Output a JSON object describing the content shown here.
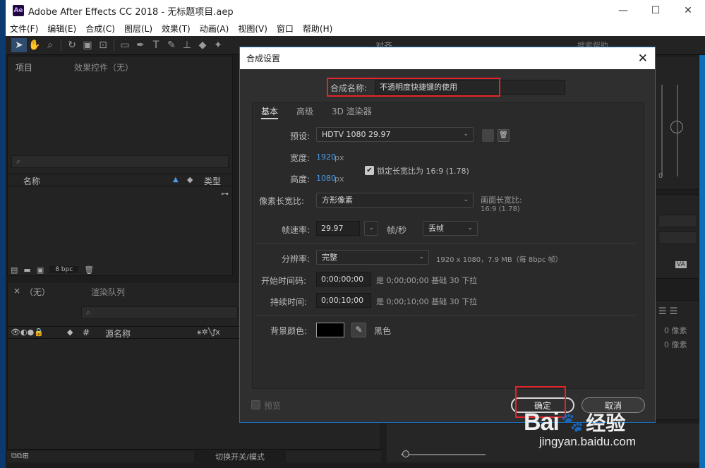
{
  "window": {
    "title": "Adobe After Effects CC 2018 - 无标题项目.aep",
    "logo": "Ae",
    "controls": {
      "minimize": "—",
      "maximize": "☐",
      "close": "✕"
    }
  },
  "menu": [
    "文件(F)",
    "编辑(E)",
    "合成(C)",
    "图层(L)",
    "效果(T)",
    "动画(A)",
    "视图(V)",
    "窗口",
    "帮助(H)"
  ],
  "toolbar": {
    "align_label": "对齐",
    "help_search": "搜索帮助"
  },
  "project_panel": {
    "tab": "项目",
    "tab2": "效果控件（无）",
    "col_name": "名称",
    "col_type": "类型",
    "bpc": "8 bpc"
  },
  "timeline_panel": {
    "tab": "（无）",
    "tab2": "渲染队列",
    "col_hash": "#",
    "col_source": "源名称",
    "footer": "切换开关/模式"
  },
  "right_panel": {
    "val0": "0",
    "px1": "0 像素",
    "px2": "0 像素"
  },
  "dialog": {
    "title": "合成设置",
    "close": "✕",
    "name_label": "合成名称:",
    "name_value": "不透明度快捷键的使用",
    "tabs": [
      "基本",
      "高级",
      "3D 渲染器"
    ],
    "preset_label": "预设:",
    "preset_value": "HDTV 1080 29.97",
    "width_label": "宽度:",
    "width_value": "1920",
    "width_unit": "px",
    "height_label": "高度:",
    "height_value": "1080",
    "height_unit": "px",
    "lock_label": "锁定长宽比为 16:9 (1.78)",
    "pixel_aspect_label": "像素长宽比:",
    "pixel_aspect_value": "方形像素",
    "frame_aspect_label": "画面长宽比:",
    "frame_aspect_value": "16:9 (1.78)",
    "fps_label": "帧速率:",
    "fps_value": "29.97",
    "fps_unit": "帧/秒",
    "drop_frame": "丢帧",
    "resolution_label": "分辨率:",
    "resolution_value": "完整",
    "resolution_info": "1920 x 1080，7.9 MB（每 8bpc 帧）",
    "start_tc_label": "开始时间码:",
    "start_tc_value": "0;00;00;00",
    "start_tc_info": "是 0;00;00;00  基础 30  下拉",
    "duration_label": "持续时间:",
    "duration_value": "0;00;10;00",
    "duration_info": "是 0;00;10;00  基础 30  下拉",
    "bg_label": "背景颜色:",
    "bg_value": "黑色",
    "preview_label": "预览",
    "ok": "确定",
    "cancel": "取消"
  },
  "watermark": {
    "brand": "Bai",
    "brand2": "经验",
    "url": "jingyan.baidu.com"
  },
  "colors": {
    "accent": "#1c6dbd",
    "highlight": "#e5232a",
    "link_blue": "#4a9be8"
  }
}
